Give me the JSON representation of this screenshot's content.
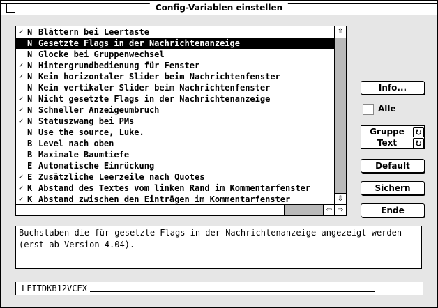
{
  "window": {
    "title": "Config-Variablen einstellen"
  },
  "list": {
    "items": [
      {
        "checked": true,
        "flag": "N",
        "label": "Blättern bei Leertaste"
      },
      {
        "checked": false,
        "flag": "N",
        "label": "Gesetzte Flags in der Nachrichtenanzeige",
        "selected": true
      },
      {
        "checked": false,
        "flag": "N",
        "label": "Glocke bei Gruppenwechsel"
      },
      {
        "checked": true,
        "flag": "N",
        "label": "Hintergrundbedienung für Fenster"
      },
      {
        "checked": true,
        "flag": "N",
        "label": "Kein horizontaler Slider beim Nachrichtenfenster"
      },
      {
        "checked": false,
        "flag": "N",
        "label": "Kein vertikaler Slider beim Nachrichtenfenster"
      },
      {
        "checked": true,
        "flag": "N",
        "label": "Nicht gesetzte Flags in der Nachrichtenanzeige"
      },
      {
        "checked": true,
        "flag": "N",
        "label": "Schneller Anzeigeumbruch"
      },
      {
        "checked": true,
        "flag": "N",
        "label": "Statuszwang bei PMs"
      },
      {
        "checked": false,
        "flag": "N",
        "label": "Use the source, Luke."
      },
      {
        "checked": false,
        "flag": "B",
        "label": "Level nach oben"
      },
      {
        "checked": false,
        "flag": "B",
        "label": "Maximale Baumtiefe"
      },
      {
        "checked": false,
        "flag": "E",
        "label": "Automatische Einrückung"
      },
      {
        "checked": true,
        "flag": "E",
        "label": "Zusätzliche Leerzeile nach Quotes"
      },
      {
        "checked": true,
        "flag": "K",
        "label": "Abstand des Textes vom linken Rand im Kommentarfenster"
      },
      {
        "checked": true,
        "flag": "K",
        "label": "Abstand zwischen den Einträgen im Kommentarfenster"
      }
    ]
  },
  "buttons": {
    "info": "Info...",
    "default": "Default",
    "sichern": "Sichern",
    "ende": "Ende"
  },
  "alle": {
    "label": "Alle",
    "checked": false
  },
  "cycles": {
    "gruppe": "Gruppe",
    "text": "Text"
  },
  "description": "Buchstaben die für gesetzte Flags in der Nachrichtenanzeige angezeigt werden (erst ab Version 4.04).",
  "flags_field": {
    "value": "LFITDKB12VCEX"
  }
}
